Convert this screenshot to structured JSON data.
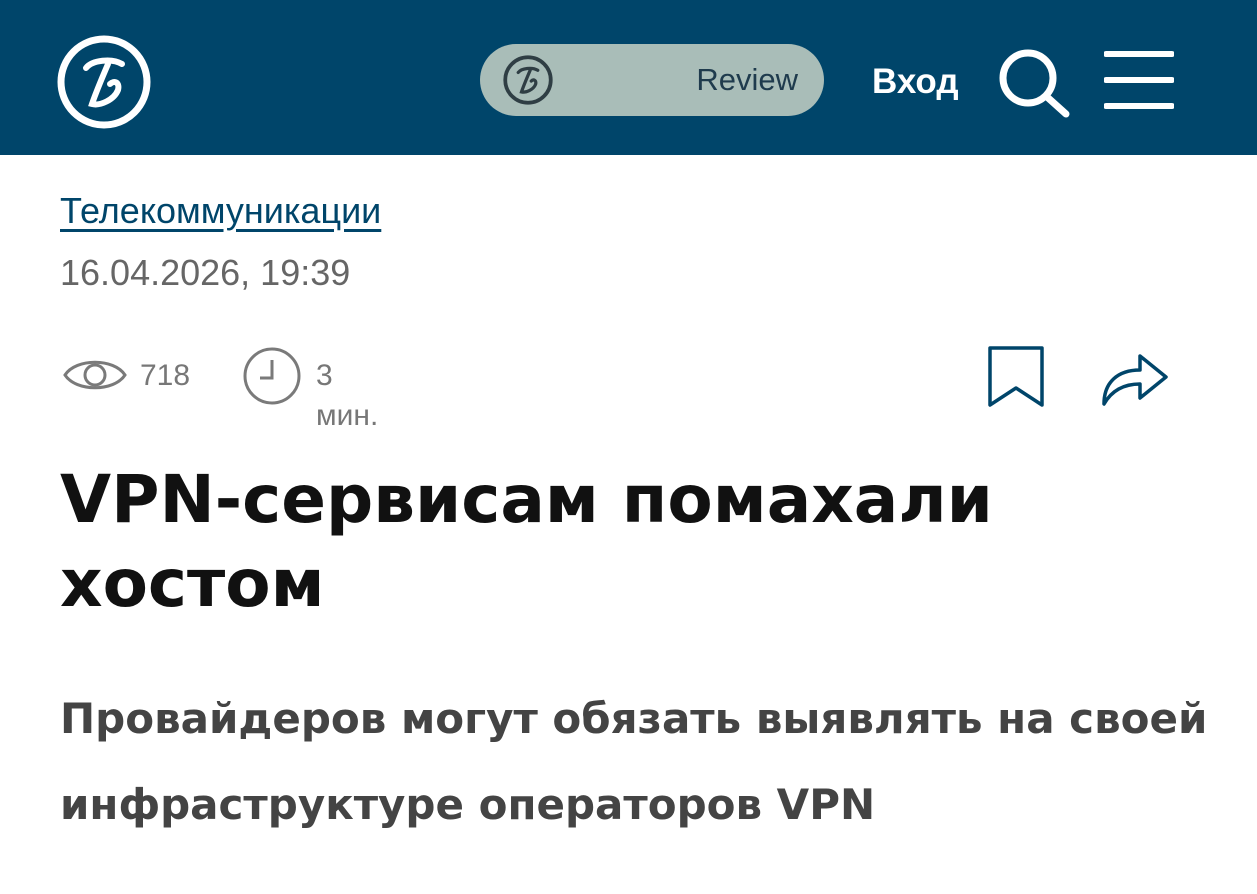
{
  "header": {
    "logo_icon": "publication-logo-icon",
    "review": {
      "label": "Review",
      "icon": "publication-logo-small-icon"
    },
    "login_label": "Вход",
    "search_icon": "search-icon",
    "menu_icon": "hamburger-menu-icon",
    "background_color": "#00456a"
  },
  "article": {
    "category": "Телекоммуникации",
    "datetime": "16.04.2026, 19:39",
    "views": {
      "icon": "eye-icon",
      "count": "718"
    },
    "read_time": {
      "icon": "clock-icon",
      "label": "3 мин."
    },
    "actions": {
      "bookmark_icon": "bookmark-icon",
      "share_icon": "share-icon"
    },
    "title": "VPN-сервисам помахали хостом",
    "subtitle": "Провайдеров могут обязать выявлять на своей инфраструктуре операторов VPN"
  }
}
